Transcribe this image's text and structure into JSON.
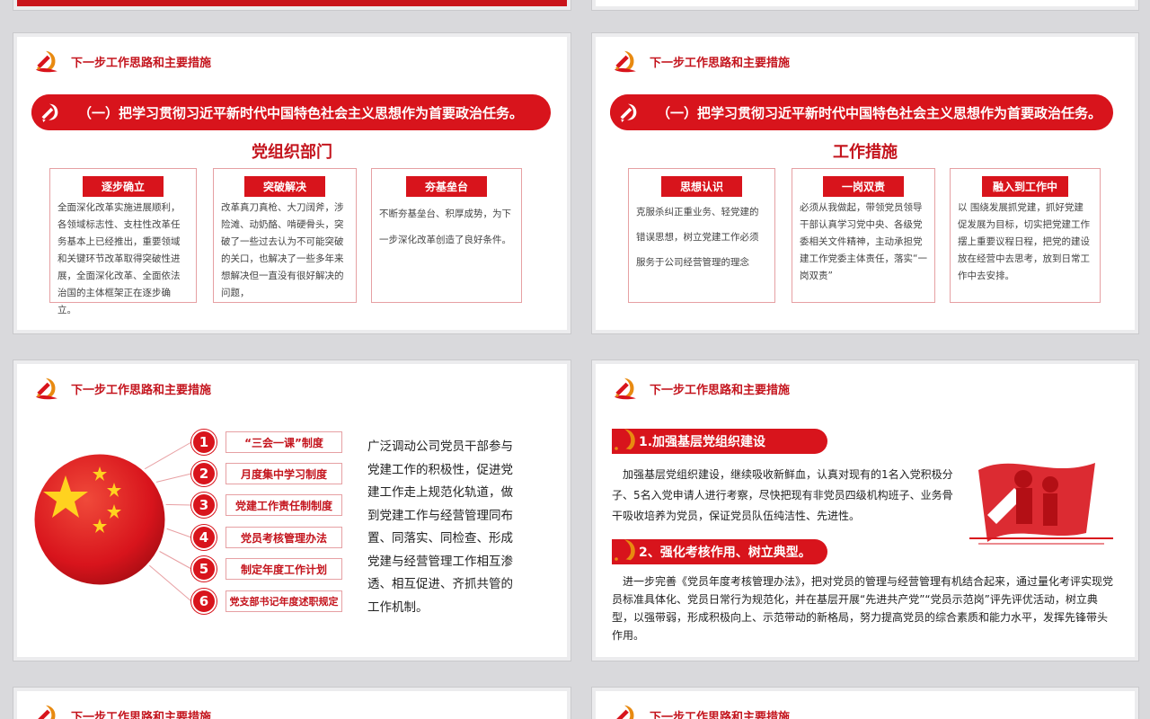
{
  "colors": {
    "accent": "#d8141c",
    "title_red": "#c4141d",
    "border_pink": "#e6a0a3"
  },
  "header_title": "下一步工作思路和主要措施",
  "banner_text": "（一）把学习贯彻习近平新时代中国特色社会主义思想作为首要政治任务。",
  "slide1": {
    "section_title": "党组织部门",
    "cards": [
      {
        "tag": "逐步确立",
        "text": "全面深化改革实施进展顺利，各领域标志性、支柱性改革任务基本上已经推出，重要领域和关键环节改革取得突破性进展，全面深化改革、全面依法治国的主体框架正在逐步确立。"
      },
      {
        "tag": "突破解决",
        "text": "改革真刀真枪、大刀阔斧，涉险滩、动奶酪、啃硬骨头，突破了一些过去认为不可能突破的关口，也解决了一些多年来想解决但一直没有很好解决的问题，"
      },
      {
        "tag": "夯基垒台",
        "text": "不断夯基垒台、积厚成势，为下一步深化改革创造了良好条件。"
      }
    ]
  },
  "slide2": {
    "section_title": "工作措施",
    "cards": [
      {
        "tag": "思想认识",
        "text": "克服杀纠正重业务、轻党建的错误思想，树立党建工作必须服务于公司经营管理的理念"
      },
      {
        "tag": "一岗双责",
        "text": "必须从我做起，带领党员领导干部认真学习党中央、各级党委相关文件精神，主动承担党建工作党委主体责任，落实“一岗双责”"
      },
      {
        "tag": "融入到工作中",
        "text": "以 围绕发展抓党建，抓好党建促发展为目标，切实把党建工作摆上重要议程日程，把党的建设放在经营中去思考，放到日常工作中去安排。"
      }
    ]
  },
  "slide3": {
    "items": [
      {
        "num": "1",
        "label": "“三会一课”制度"
      },
      {
        "num": "2",
        "label": "月度集中学习制度"
      },
      {
        "num": "3",
        "label": "党建工作责任制制度"
      },
      {
        "num": "4",
        "label": "党员考核管理办法"
      },
      {
        "num": "5",
        "label": "制定年度工作计划"
      },
      {
        "num": "6",
        "label": "党支部书记年度述职规定"
      }
    ],
    "paragraph": "广泛调动公司党员干部参与党建工作的积极性，促进党建工作走上规范化轨道，做到党建工作与经营管理同布置、同落实、同检查、形成党建与经营管理工作相互渗透、相互促进、齐抓共管的工作机制。"
  },
  "slide4": {
    "h1": "1.加强基层党组织建设",
    "p1": "加强基层党组织建设，继续吸收新鲜血，认真对现有的1名入党积极分子、5名入党申请人进行考察，尽快把现有非党员四级机构班子、业务骨干吸收培养为党员，保证党员队伍纯洁性、先进性。",
    "h2": "2、强化考核作用、树立典型。",
    "p2": "进一步完善《党员年度考核管理办法》，把对党员的管理与经营管理有机结合起来，通过量化考评实现党员标准具体化、党员日常行为规范化，并在基层开展“先进共产党”“党员示范岗”评先评优活动，树立典型，以强带弱，形成积极向上、示范带动的新格局，努力提高党员的综合素质和能力水平，发挥先锋带头作用。"
  }
}
